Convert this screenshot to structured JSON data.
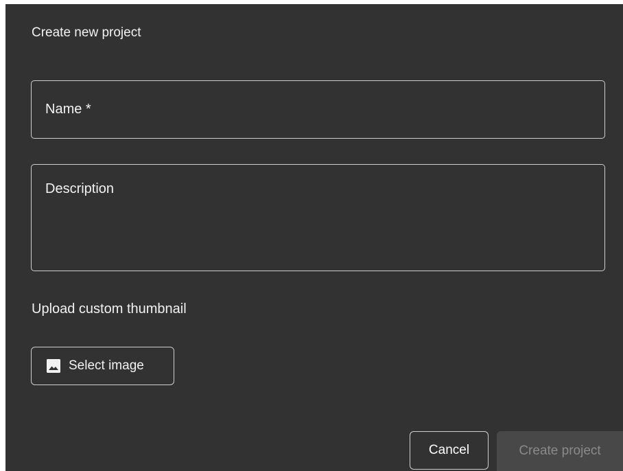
{
  "dialog": {
    "title": "Create new project",
    "name_field": {
      "placeholder": "Name *",
      "value": ""
    },
    "description_field": {
      "placeholder": "Description",
      "value": ""
    },
    "upload_label": "Upload custom thumbnail",
    "select_image_button": {
      "label": "Select image",
      "icon": "image-icon"
    },
    "cancel_button": {
      "label": "Cancel"
    },
    "create_button": {
      "label": "Create project",
      "disabled": true
    }
  },
  "colors": {
    "dialog_background": "#323232",
    "border": "#cfcfcf",
    "text": "#f2f2f2",
    "disabled_button_background": "#484848",
    "disabled_button_text": "#8a8a8a"
  }
}
